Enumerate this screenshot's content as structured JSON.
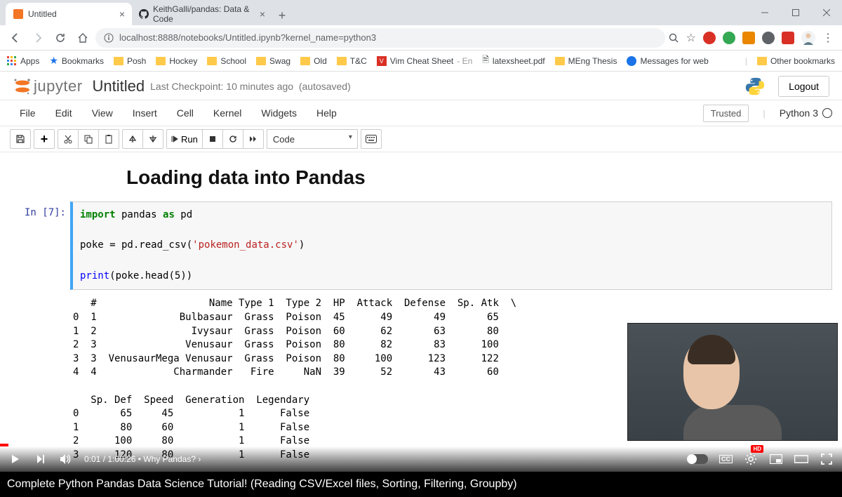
{
  "browser": {
    "tabs": [
      {
        "title": "Untitled",
        "active": true
      },
      {
        "title": "KeithGalli/pandas: Data & Code",
        "active": false
      }
    ],
    "url": "localhost:8888/notebooks/Untitled.ipynb?kernel_name=python3",
    "bookmarks": [
      "Posh",
      "Hockey",
      "School",
      "Swag",
      "Old",
      "T&C"
    ],
    "bm_other": [
      {
        "label": "Vim Cheat Sheet",
        "suffix": "- En"
      },
      {
        "label": "latexsheet.pdf"
      },
      {
        "label": "MEng Thesis"
      },
      {
        "label": "Messages for web"
      }
    ],
    "other_bookmarks": "Other bookmarks",
    "apps_label": "Apps",
    "bookmarks_label": "Bookmarks"
  },
  "jupyter": {
    "brand": "jupyter",
    "title": "Untitled",
    "checkpoint": "Last Checkpoint: 10 minutes ago",
    "autosaved": "(autosaved)",
    "logout": "Logout",
    "menus": [
      "File",
      "Edit",
      "View",
      "Insert",
      "Cell",
      "Kernel",
      "Widgets",
      "Help"
    ],
    "trusted": "Trusted",
    "kernel": "Python 3",
    "run_label": "Run",
    "cell_type": "Code"
  },
  "notebook": {
    "heading": "Loading data into Pandas",
    "prompt": "In [7]:",
    "code_lines": [
      [
        {
          "t": "import",
          "c": "kw"
        },
        {
          "t": " pandas ",
          "c": "nm"
        },
        {
          "t": "as",
          "c": "kw"
        },
        {
          "t": " pd",
          "c": "nm"
        }
      ],
      [],
      [
        {
          "t": "poke = pd.read_csv(",
          "c": "nm"
        },
        {
          "t": "'pokemon_data.csv'",
          "c": "str"
        },
        {
          "t": ")",
          "c": "nm"
        }
      ],
      [],
      [
        {
          "t": "print",
          "c": "fn"
        },
        {
          "t": "(poke.head(",
          "c": "nm"
        },
        {
          "t": "5",
          "c": "nm"
        },
        {
          "t": "))",
          "c": "nm"
        }
      ]
    ],
    "output": "   #                   Name Type 1  Type 2  HP  Attack  Defense  Sp. Atk  \\\n0  1              Bulbasaur  Grass  Poison  45      49       49       65   \n1  2                Ivysaur  Grass  Poison  60      62       63       80   \n2  3               Venusaur  Grass  Poison  80      82       83      100   \n3  3  VenusaurMega Venusaur  Grass  Poison  80     100      123      122   \n4  4             Charmander   Fire     NaN  39      52       43       60   \n\n   Sp. Def  Speed  Generation  Legendary  \n0       65     45           1      False  \n1       80     60           1      False  \n2      100     80           1      False  \n3      120     80           1      False  "
  },
  "video": {
    "time_current": "0:01",
    "time_total": "1:00:26",
    "chapter": "Why Pandas?",
    "title": "Complete Python Pandas Data Science Tutorial! (Reading CSV/Excel files, Sorting, Filtering, Groupby)",
    "hd": "HD"
  }
}
